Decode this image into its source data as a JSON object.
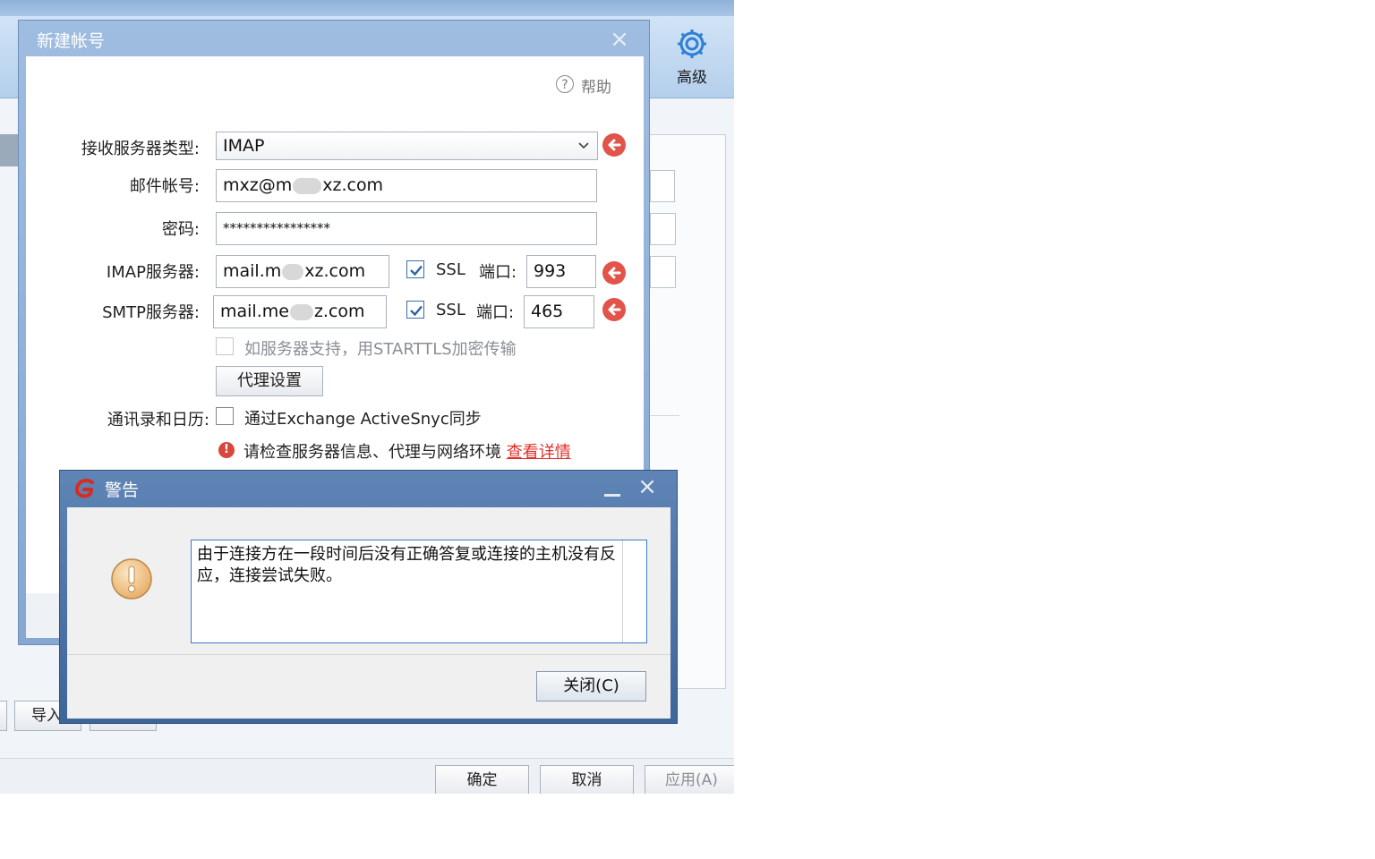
{
  "background_window": {
    "advanced_label": "高级",
    "import_label": "导入",
    "buttons": {
      "ok": "确定",
      "cancel": "取消",
      "apply": "应用(A)"
    }
  },
  "new_account_dialog": {
    "title": "新建帐号",
    "help_label": "帮助",
    "server_type": {
      "label": "接收服务器类型:",
      "value": "IMAP"
    },
    "email": {
      "label": "邮件帐号:",
      "value_prefix": "mxz@m",
      "value_suffix": "xz.com"
    },
    "password": {
      "label": "密码:",
      "value": "****************"
    },
    "imap": {
      "label": "IMAP服务器:",
      "value_prefix": "mail.m",
      "value_suffix": "xz.com",
      "ssl_label": "SSL",
      "ssl_checked": true,
      "port_label": "端口:",
      "port": "993"
    },
    "smtp": {
      "label": "SMTP服务器:",
      "value_prefix": "mail.me",
      "value_suffix": "z.com",
      "ssl_label": "SSL",
      "ssl_checked": true,
      "port_label": "端口:",
      "port": "465"
    },
    "starttls_label": "如服务器支持，用STARTTLS加密传输",
    "proxy_button": "代理设置",
    "contacts_label": "通讯录和日历:",
    "activesync_label": "通过Exchange ActiveSnyc同步",
    "error_text": "请检查服务器信息、代理与网络环境",
    "error_link": "查看详情"
  },
  "warning_dialog": {
    "title": "警告",
    "message": "由于连接方在一段时间后没有正确答复或连接的主机没有反应，连接尝试失败。",
    "close_button": "关闭(C)"
  }
}
